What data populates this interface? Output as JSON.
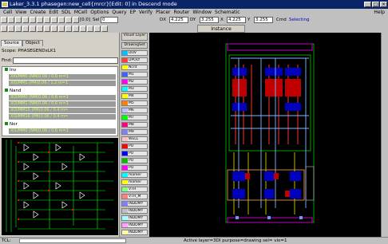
{
  "window": {
    "title": "Laker_3.3.1 phasegen:new_cell{mrcr}[Edit: 0] in Descend mode",
    "min": "_",
    "max": "□",
    "close": "×"
  },
  "menu": [
    "Cell",
    "View",
    "Create",
    "Edit",
    "SDL",
    "MCell",
    "Options",
    "Query",
    "EP",
    "Verify",
    "Placer",
    "Router",
    "Window",
    "Schematic"
  ],
  "menu_help": "Help",
  "toolbar": {
    "sel_label": "Sel",
    "sel_value": "0",
    "dx_label": "DX",
    "dx_value": "4.225",
    "dy_label": "DY",
    "dy_value": "3.255",
    "x_label": "X",
    "x_value": "4.225",
    "y_label": "Y",
    "y_value": "3.255",
    "cmd_label": "Cmd",
    "cmd_value": "Selecting",
    "coords": "[0.0]"
  },
  "left": {
    "tabs": [
      "Source",
      "Object"
    ],
    "scope_label": "Scope:",
    "scope_value": "PHASEGENDxLK1",
    "find_label": "Find:",
    "groups": [
      {
        "name": "Inv",
        "items": [
          "XI0/MM0 (NM(0.06 / 0.6 m=1",
          "XI0/MM1 (PM(0.06 / 1.2 m=1"
        ]
      },
      {
        "name": "Nand",
        "items": [
          "XI3/MM0 (NM(0.06 / 0.6 m=1",
          "XI3/MM1 (NM(0.06 / 0.6 m=1",
          "XI3/MM15 (PM(0.06 / 0.4 m=",
          "XI3/MM16 (PM(0.06 / 0.4 m="
        ]
      },
      {
        "name": "Nor",
        "items": [
          "XI1/MM0 (NM(0.06 / 0.6 m=1"
        ]
      }
    ]
  },
  "layers": {
    "header_top": "Visuel Layer",
    "drawing_set": "DrawingSet",
    "items": [
      {
        "label": "DOV",
        "color": "#00c0ff"
      },
      {
        "label": "DPOLY",
        "color": "#ff4040"
      },
      {
        "label": "Ncnt",
        "color": "#ffff00"
      },
      {
        "label": "M1",
        "color": "#4060ff"
      },
      {
        "label": "M2",
        "color": "#ff00ff"
      },
      {
        "label": "M3",
        "color": "#00ffff"
      },
      {
        "label": "M4",
        "color": "#ffff00"
      },
      {
        "label": "M5",
        "color": "#ff8000"
      },
      {
        "label": "M6",
        "color": "#c0c0ff"
      },
      {
        "label": "M7",
        "color": "#00ff00"
      },
      {
        "label": "M8",
        "color": "#ff0080"
      },
      {
        "label": "M9",
        "color": "#8080ff"
      },
      {
        "label": "WELL",
        "color": "#ffc0c0"
      },
      {
        "label": "PO",
        "color": "#ff0000"
      },
      {
        "label": "PO",
        "color": "#0000ff"
      },
      {
        "label": "PO",
        "color": "#00c000"
      },
      {
        "label": "PO",
        "color": "#ff00ff"
      },
      {
        "label": "marker",
        "color": "#00ffff"
      },
      {
        "label": "marker",
        "color": "#ffff00"
      },
      {
        "label": "VTH",
        "color": "#80ff80"
      },
      {
        "label": "VTH_M",
        "color": "#ff8080"
      },
      {
        "label": "INDDMY",
        "color": "#8080ff"
      },
      {
        "label": "INDDMY",
        "color": "#c0c0c0"
      },
      {
        "label": "INDDMY",
        "color": "#a0ffff"
      },
      {
        "label": "INDDMY",
        "color": "#ffa0ff"
      },
      {
        "label": "INDDMY",
        "color": "#ffffa0"
      }
    ]
  },
  "instance_tab": "Instance",
  "status": {
    "left": "TCL:",
    "message": "Active layer=3DI purpose=drawing sel= vio=1"
  }
}
